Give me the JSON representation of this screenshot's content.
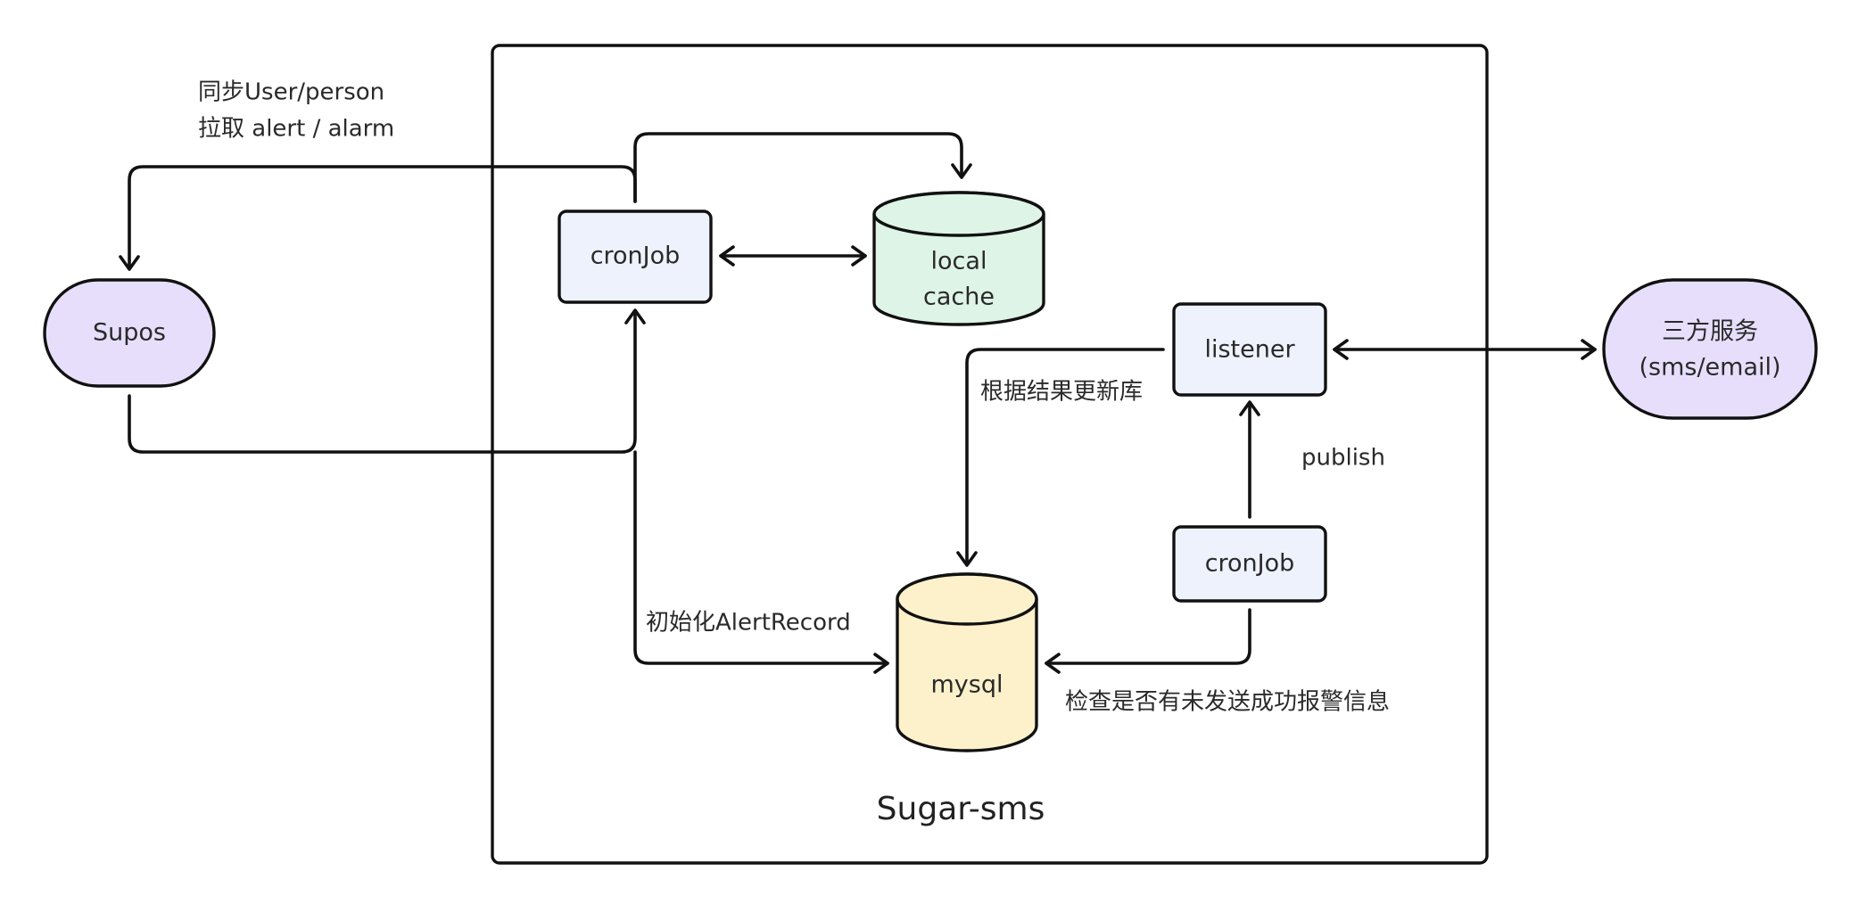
{
  "colors": {
    "stroke": "#111111",
    "text": "#2a2a2a",
    "process_fill": "#eef2fd",
    "terminal_fill": "#e7defc",
    "cache_fill": "#def4e7",
    "db_fill": "#fdf1cc",
    "container_fill": "#ffffff"
  },
  "container": {
    "label": "Sugar-sms"
  },
  "nodes": {
    "supos": {
      "label": "Supos",
      "shape": "rounded-terminal"
    },
    "cronjob_top": {
      "label": "cronJob",
      "shape": "process"
    },
    "local_cache": {
      "line1": "local",
      "line2": "cache",
      "shape": "database"
    },
    "listener": {
      "label": "listener",
      "shape": "process"
    },
    "third_party": {
      "line1": "三方服务",
      "line2": "(sms/email)",
      "shape": "rounded-terminal"
    },
    "mysql": {
      "label": "mysql",
      "shape": "database"
    },
    "cronjob_bottom": {
      "label": "cronJob",
      "shape": "process"
    }
  },
  "edges": {
    "sync": {
      "line1": "同步User/person",
      "line2": "拉取 alert / alarm"
    },
    "update_db": {
      "label": "根据结果更新库"
    },
    "publish": {
      "label": "publish"
    },
    "init_alert_record": {
      "label": "初始化AlertRecord"
    },
    "check_unsent": {
      "label": "检查是否有未发送成功报警信息"
    }
  }
}
